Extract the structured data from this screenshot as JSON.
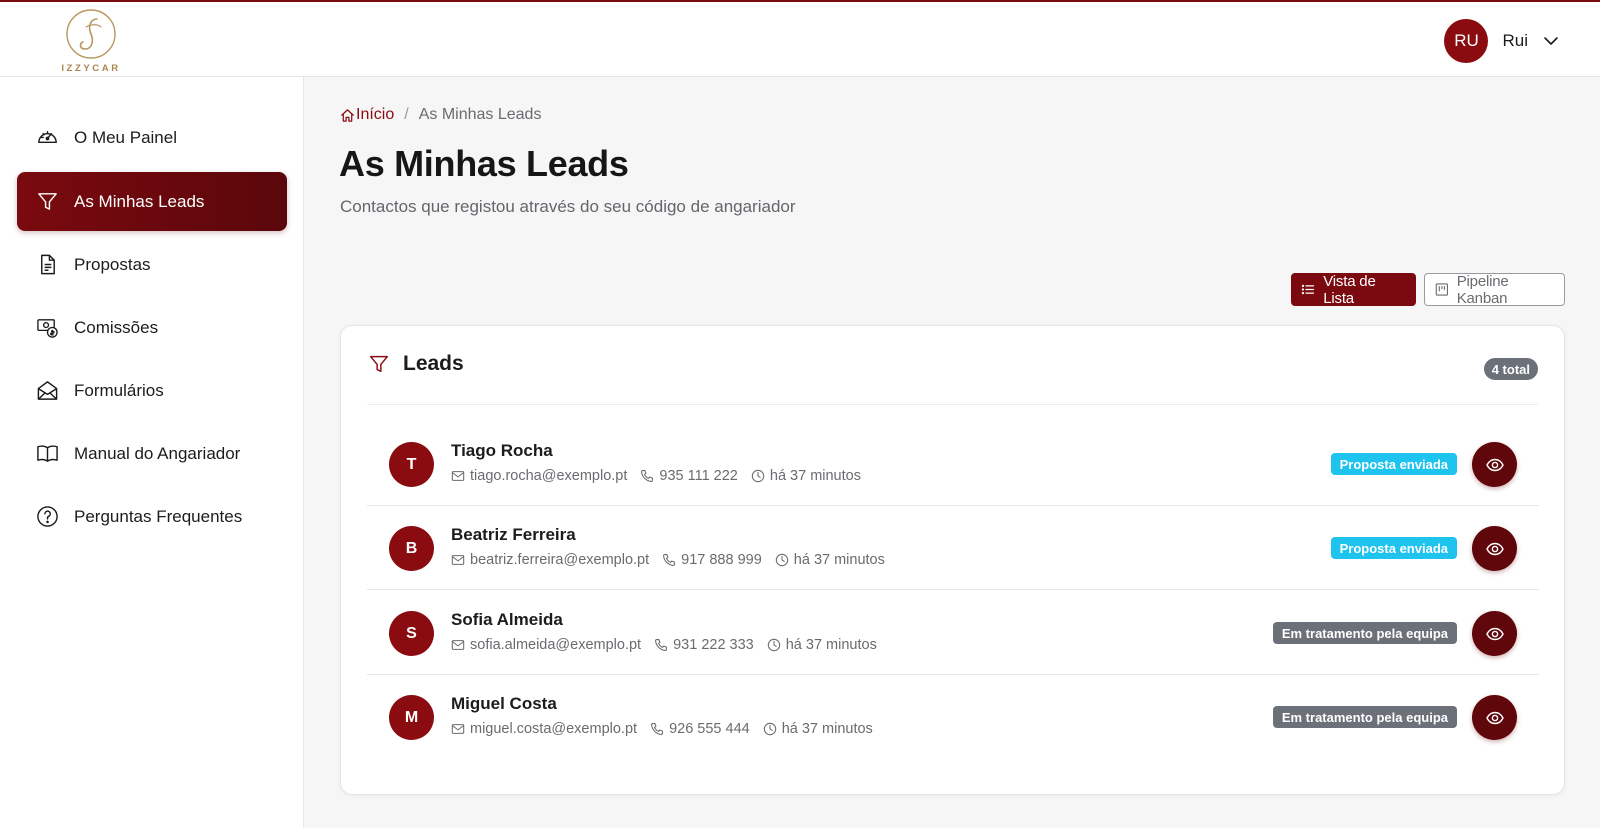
{
  "brand": {
    "logo_text": "IZZYCAR",
    "accent": "#7a0a0f"
  },
  "user": {
    "initials": "RU",
    "name": "Rui"
  },
  "sidebar": {
    "items": [
      {
        "label": "O Meu Painel",
        "icon": "dashboard-gauge-icon",
        "active": false
      },
      {
        "label": "As Minhas Leads",
        "icon": "funnel-icon",
        "active": true
      },
      {
        "label": "Propostas",
        "icon": "document-icon",
        "active": false
      },
      {
        "label": "Comissões",
        "icon": "commission-money-icon",
        "active": false
      },
      {
        "label": "Formulários",
        "icon": "envelope-open-icon",
        "active": false
      },
      {
        "label": "Manual do Angariador",
        "icon": "book-icon",
        "active": false
      },
      {
        "label": "Perguntas Frequentes",
        "icon": "question-circle-icon",
        "active": false
      }
    ]
  },
  "breadcrumb": {
    "home": "Início",
    "separator": "/",
    "current": "As Minhas Leads"
  },
  "page": {
    "title": "As Minhas Leads",
    "subtitle": "Contactos que registou através do seu código de angariador"
  },
  "view_toggle": {
    "list_label": "Vista de Lista",
    "kanban_label": "Pipeline Kanban",
    "selected": "list"
  },
  "leads_card": {
    "title": "Leads",
    "total_badge": "4 total",
    "leads": [
      {
        "initial": "T",
        "name": "Tiago Rocha",
        "email": "tiago.rocha@exemplo.pt",
        "phone": "935 111 222",
        "time": "há 37 minutos",
        "status": "Proposta enviada",
        "status_color": "#1ec3ee"
      },
      {
        "initial": "B",
        "name": "Beatriz Ferreira",
        "email": "beatriz.ferreira@exemplo.pt",
        "phone": "917 888 999",
        "time": "há 37 minutos",
        "status": "Proposta enviada",
        "status_color": "#1ec3ee"
      },
      {
        "initial": "S",
        "name": "Sofia Almeida",
        "email": "sofia.almeida@exemplo.pt",
        "phone": "931 222 333",
        "time": "há 37 minutos",
        "status": "Em tratamento pela equipa",
        "status_color": "#6b7079"
      },
      {
        "initial": "M",
        "name": "Miguel Costa",
        "email": "miguel.costa@exemplo.pt",
        "phone": "926 555 444",
        "time": "há 37 minutos",
        "status": "Em tratamento pela equipa",
        "status_color": "#6b7079"
      }
    ]
  }
}
